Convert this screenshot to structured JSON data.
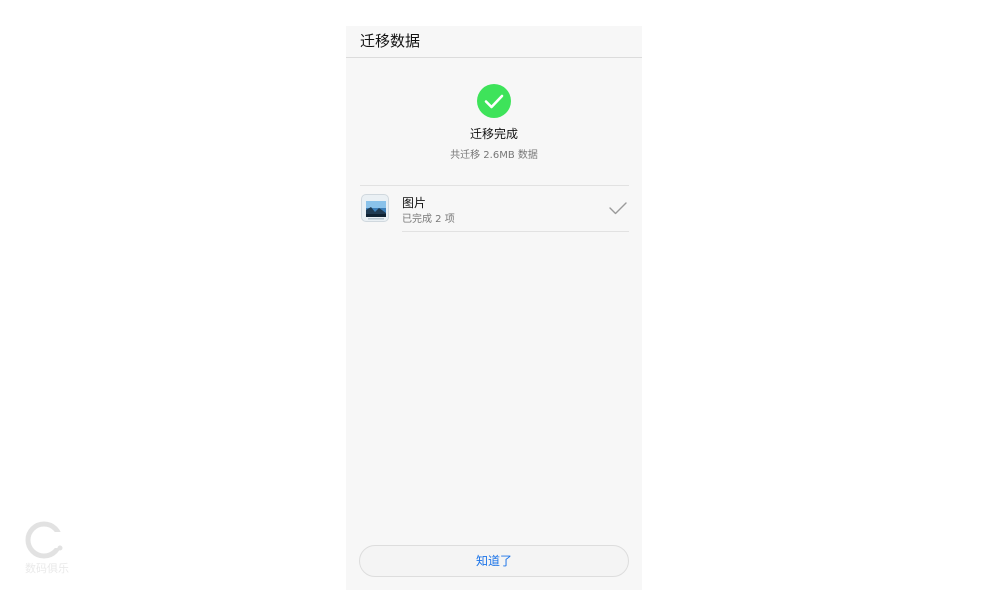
{
  "header": {
    "title": "迁移数据"
  },
  "status": {
    "icon": "checkmark-circle-icon",
    "title": "迁移完成",
    "subtitle": "共迁移 2.6MB 数据"
  },
  "items": [
    {
      "icon": "gallery-icon",
      "label": "图片",
      "detail": "已完成 2 项",
      "done_icon": "checkmark-icon"
    }
  ],
  "footer": {
    "ok_label": "知道了"
  },
  "watermark": {
    "logo": "watermark-logo",
    "text": "数码俱乐"
  },
  "colors": {
    "success": "#3ee35a",
    "accent": "#1a73e8",
    "background": "#f7f7f7"
  }
}
